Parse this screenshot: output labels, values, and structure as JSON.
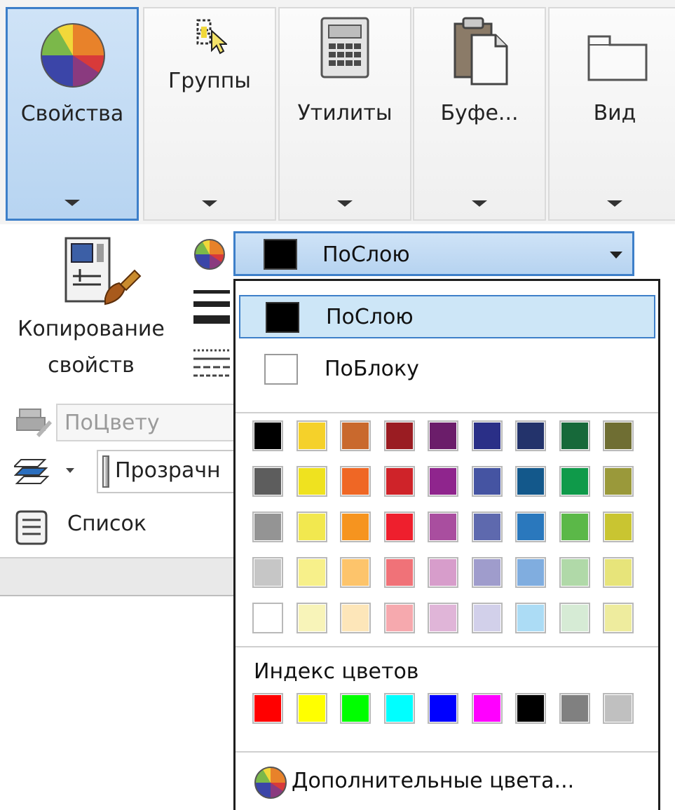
{
  "ribbon": {
    "buttons": [
      {
        "label": "Свойства",
        "active": true
      },
      {
        "label": "Группы",
        "active": false
      },
      {
        "label": "Утилиты",
        "active": false
      },
      {
        "label": "Буфе...",
        "active": false
      },
      {
        "label": "Вид",
        "active": false
      }
    ]
  },
  "panel": {
    "copy_label_line1": "Копирование",
    "copy_label_line2": "свойств",
    "plot_style_value": "ПоЦвету",
    "transparency_value": "Прозрачн",
    "list_label": "Список"
  },
  "color_combo": {
    "selected_label": "ПоСлою",
    "selected_color": "#000000"
  },
  "dropdown": {
    "items": [
      {
        "label": "ПоСлою",
        "color": "#000000",
        "selected": true
      },
      {
        "label": "ПоБлоку",
        "color": "#ffffff",
        "selected": false
      }
    ],
    "palette": [
      [
        "#000000",
        "#f5d12a",
        "#c9692d",
        "#9a1c22",
        "#6b1d6a",
        "#2a2f87",
        "#23336b",
        "#17693a",
        "#6f6e33"
      ],
      [
        "#5d5d5d",
        "#efe21f",
        "#ef6725",
        "#cf2329",
        "#8f258d",
        "#4554a2",
        "#13588b",
        "#0f9a4a",
        "#9a993a"
      ],
      [
        "#949494",
        "#f2e84f",
        "#f6941f",
        "#ee1f2d",
        "#a94e9f",
        "#5e69ae",
        "#2a78bd",
        "#5bb848",
        "#c9c531"
      ],
      [
        "#c6c6c6",
        "#f7f08a",
        "#fdc46b",
        "#f07278",
        "#d79dcb",
        "#9f9ccc",
        "#80addf",
        "#b0d9a8",
        "#e7e47a"
      ],
      [
        "#ffffff",
        "#f8f4b9",
        "#fde6b9",
        "#f6a9ae",
        "#e0b5d8",
        "#d2d0ea",
        "#acdcf5",
        "#d6ebd5",
        "#eeec9e"
      ]
    ],
    "index_colors_label": "Индекс цветов",
    "index_colors": [
      "#ff0000",
      "#ffff00",
      "#00ff00",
      "#00ffff",
      "#0000ff",
      "#ff00ff",
      "#000000",
      "#808080",
      "#c0c0c0"
    ],
    "more_colors_label": "Дополнительные цвета..."
  }
}
